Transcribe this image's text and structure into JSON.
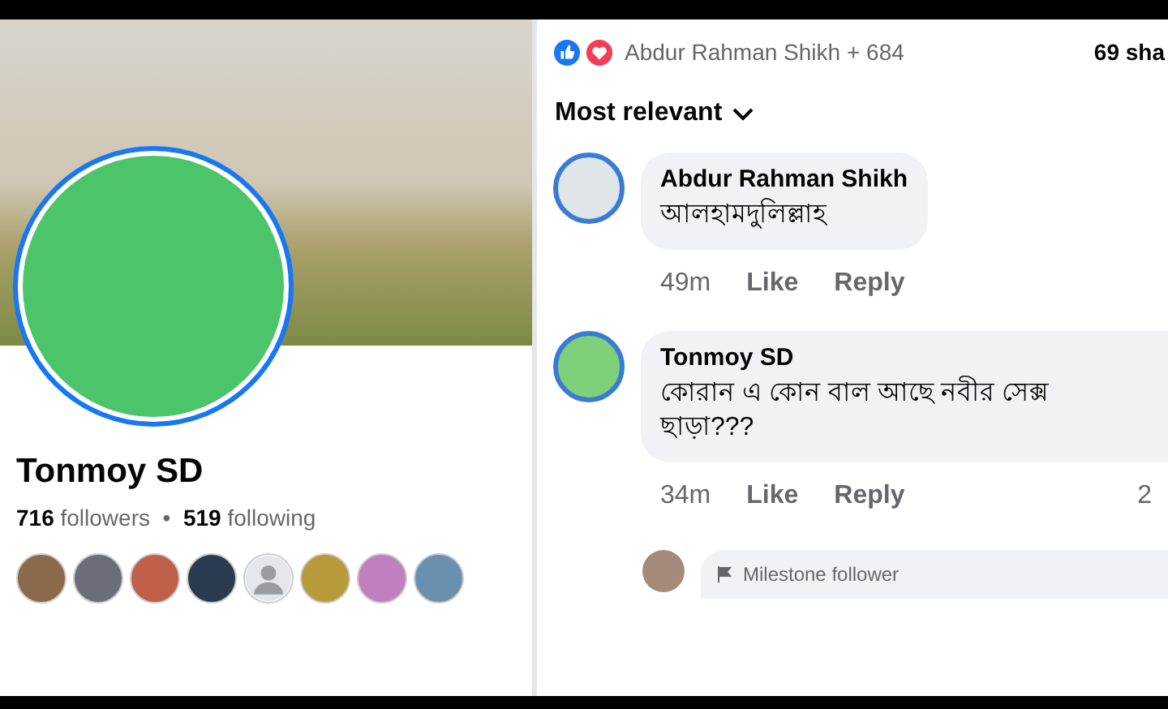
{
  "profile": {
    "name": "Tonmoy SD",
    "stats": "**716** followers  •  **519** following"
  },
  "reactions": {
    "names": "Abdur Rahman Shikh + 684",
    "shares": "69 sha"
  },
  "sort": {
    "label": "Most relevant"
  },
  "comments": [
    {
      "author": "Abdur Rahman Shikh",
      "text": "আলহামদুলিল্লাহ",
      "time": "49m",
      "like": "Like",
      "reply": "Reply"
    },
    {
      "author": "Tonmoy SD",
      "text": "কোরান এ কোন বাল আছে নবীর সেক্স ছাড়া???",
      "time": "34m",
      "like": "Like",
      "reply": "Reply",
      "reaction_count": "2"
    }
  ],
  "partial_comment": {
    "badge": "Milestone follower"
  }
}
